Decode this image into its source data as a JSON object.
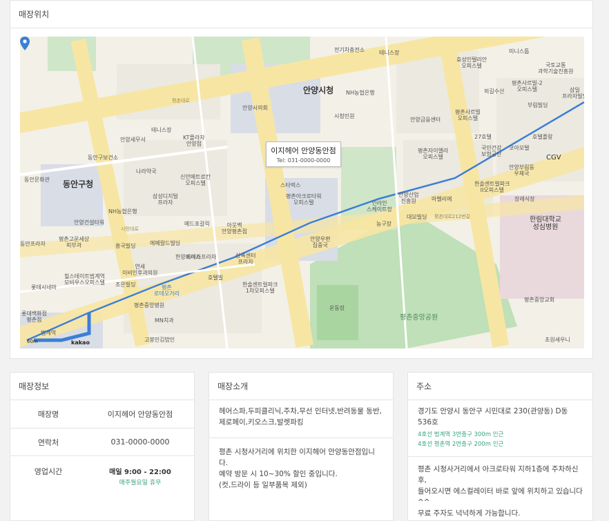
{
  "map_section": {
    "title": "매장위치",
    "popup": {
      "name": "이지헤어 안양동안점",
      "tel": "Tel: 031-0000-0000"
    },
    "logo": "kakao",
    "scale": "60m",
    "labels": {
      "anyang_city_hall": "안양시청",
      "dongan_office": "동안구청",
      "pyeongchon_park": "평촌중앙공원",
      "starbucks": "스타벅스",
      "acro_tower": "평촌아크로타워\n오피스텔",
      "anyang_post": "안양우편\n집중국",
      "bank": "NH농협은행",
      "anyang_police": "안양시의회",
      "cityhall_station": "시청민원",
      "electronics": "전기차충전소",
      "tennis": "테니스장",
      "hyosung": "효성인텔리안\n오피스텔",
      "miniseum": "미니스톱",
      "science_center": "국토교통\n과학기술진흥원",
      "officetel_2": "평촌사르빌-2\n오피스텔",
      "samil": "삼일\n프라자빌딩",
      "boorim": "부림빌딩",
      "pyeongchon_officetel": "평촌사르빌\n오피스텔",
      "cgv": "CGV",
      "hallym": "한림대학교\n성심병원",
      "pyeongchon_church": "평촌중앙교회",
      "chowon": "초원세우니",
      "sports": "운동장",
      "dongan_plaza": "동안프라자",
      "dongan_health": "동안구보건소",
      "narayakguk": "나라약국",
      "kt_plaza": "KT플라자\n안양점",
      "samsung": "삼성디지털\n프라자",
      "shinan": "신안메트로칸\n오피스텔",
      "tennis2": "테니스장",
      "anyang_bank": "안양세무서",
      "anyang_station": "범계역",
      "mediplace": "메드포갈릭",
      "outback": "아웃백\n안양평촌점",
      "hanyang": "한양프라자",
      "sangrok": "상록센터\n프라자",
      "hotel": "호텔빌",
      "hansol": "한솔센트럴파크\n1차오피스텔",
      "pyeongchon_bank": "평촌중앙병원",
      "mn_clinic": "MN치과",
      "gobongmin": "고봉민김밥인",
      "lotte": "롯데시네마",
      "lotte_dept": "롯데백화점\n평촌점",
      "hillstate": "힐스테이트범계역\n모비우스오피스텔",
      "joeun": "조은빌딩",
      "yeonse": "연세\n이비인후과의원",
      "heungguk": "흥국빌딩",
      "emerald": "에메랄드빌딩",
      "apollo": "에이스프라자",
      "anyang_construction": "안양건설타워",
      "pyeongchon_dental": "평촌고운세상\n피부과",
      "nh_bank2": "NH농협은행",
      "anyang_sanup": "안양산업\n진흥원",
      "mabelle": "마벨리에",
      "daemo": "대모빌딩",
      "financial": "안양금융센터",
      "pyeongchon_gelra": "평촌자이엘라\n오피스텔",
      "korea_health": "국민건강\n보험공단",
      "core_motel": "코아모텔",
      "ansan_post": "안양부림동\n우체국",
      "hansol2": "한솔센트럴파크\nII오피스텔",
      "jangrye": "장례식장",
      "hotel_plaza": "호텔플랑",
      "motel27": "27호텔",
      "oegaesu": "외길수산",
      "pyeongchon_street": "평촌\n로데오거리",
      "dongan_park": "동안문화관",
      "green_hall": "인라인\n스케이트장",
      "pool": "농구장",
      "road_cityhall": "시민대로",
      "road_pyeongchon": "평촌대로",
      "road_g": "평촌대로212번길"
    },
    "icons": [
      "cafe-icon",
      "bank-icon",
      "pharmacy-icon",
      "bus-icon",
      "restaurant-icon",
      "hospital-icon",
      "subway-icon"
    ]
  },
  "store_info": {
    "title": "매장정보",
    "rows": [
      {
        "label": "매장명",
        "value": "이지헤어 안양동안점"
      },
      {
        "label": "연락처",
        "value": "031-0000-0000"
      },
      {
        "label": "영업시간",
        "value": "매일 9:00 - 22:00",
        "sub": "매주월요일 휴무"
      }
    ]
  },
  "store_intro": {
    "title": "매장소개",
    "facilities": "헤어스파,두피클리닉,주차,무선 인터넷,반려동물 동반,제로페이,키오스크,발렛파킹",
    "description": "평촌 시청사거리에 위치한 이지헤어 안양동안점입니다.\n예약 방문 시 10~30% 할인 중입니다.\n(컷,드라이 등 일부품목 제외)"
  },
  "address": {
    "title": "주소",
    "main": "경기도 안양시 동안구 시민대로 230(관양동) D동 536호",
    "subway1": "4호선 범계역 3번출구 300m 인근",
    "subway2": "4호선 평촌역 2번출구 200m 인근",
    "parking": "평촌 시청사거리에서 아크로타워 지하1층에 주차하신 후,\n들어오시면 에스컬레이터 바로 앞에 위치하고 있습니다^^\n무료 주자도 넉넉하게 가능합니다."
  },
  "colors": {
    "accent_green": "#3aa37f",
    "route_blue": "#3b7fd6",
    "road_yellow": "#f7e6a3",
    "park_green": "#cfe6c8",
    "block_gray": "#e6e4de"
  }
}
